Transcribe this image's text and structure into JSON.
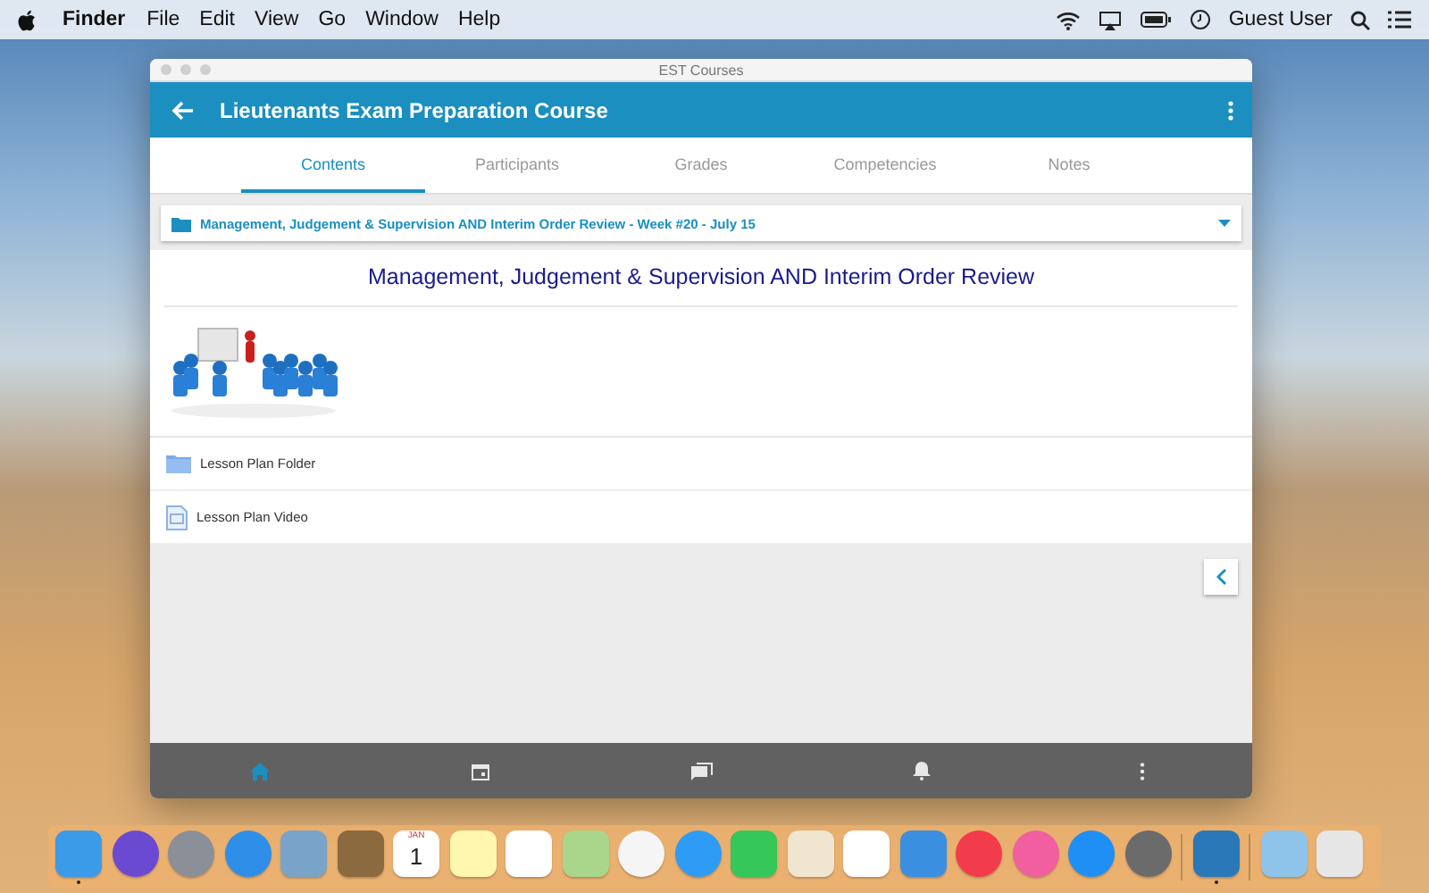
{
  "menu_bar": {
    "app": "Finder",
    "items": [
      "File",
      "Edit",
      "View",
      "Go",
      "Window",
      "Help"
    ],
    "user": "Guest User"
  },
  "window": {
    "title": "EST Courses"
  },
  "header": {
    "title": "Lieutenants Exam Preparation Course"
  },
  "tabs": [
    {
      "label": "Contents",
      "selected": true
    },
    {
      "label": "Participants",
      "selected": false
    },
    {
      "label": "Grades",
      "selected": false
    },
    {
      "label": "Competencies",
      "selected": false
    },
    {
      "label": "Notes",
      "selected": false
    }
  ],
  "section_dropdown": {
    "value": "Management, Judgement & Supervision AND Interim Order Review - Week #20 - July 15"
  },
  "section": {
    "heading": "Management, Judgement & Supervision AND Interim Order Review",
    "items": [
      {
        "kind": "folder",
        "label": "Lesson Plan Folder"
      },
      {
        "kind": "file",
        "label": "Lesson Plan Video"
      }
    ]
  },
  "bottom_nav": [
    {
      "kind": "home",
      "selected": true
    },
    {
      "kind": "calendar",
      "selected": false
    },
    {
      "kind": "messages",
      "selected": false
    },
    {
      "kind": "bell",
      "selected": false
    },
    {
      "kind": "more",
      "selected": false
    }
  ],
  "dock": [
    {
      "kind": "finder",
      "running": true
    },
    {
      "kind": "siri",
      "running": false
    },
    {
      "kind": "rocket",
      "running": false
    },
    {
      "kind": "compass",
      "running": false
    },
    {
      "kind": "bird",
      "running": false
    },
    {
      "kind": "book",
      "running": false
    },
    {
      "kind": "calendar",
      "running": false,
      "month": "JAN",
      "day": "1"
    },
    {
      "kind": "notes",
      "running": false
    },
    {
      "kind": "list",
      "running": false
    },
    {
      "kind": "map",
      "running": false
    },
    {
      "kind": "flower",
      "running": false
    },
    {
      "kind": "chat",
      "running": false
    },
    {
      "kind": "phone",
      "running": false
    },
    {
      "kind": "pen",
      "running": false
    },
    {
      "kind": "bars",
      "running": false
    },
    {
      "kind": "easel",
      "running": false
    },
    {
      "kind": "news",
      "running": false
    },
    {
      "kind": "music",
      "running": false
    },
    {
      "kind": "appstore",
      "running": false
    },
    {
      "kind": "gear",
      "running": false
    },
    {
      "kind": "separator"
    },
    {
      "kind": "app",
      "running": true
    },
    {
      "kind": "separator"
    },
    {
      "kind": "folder",
      "running": false
    },
    {
      "kind": "trash",
      "running": false
    }
  ]
}
